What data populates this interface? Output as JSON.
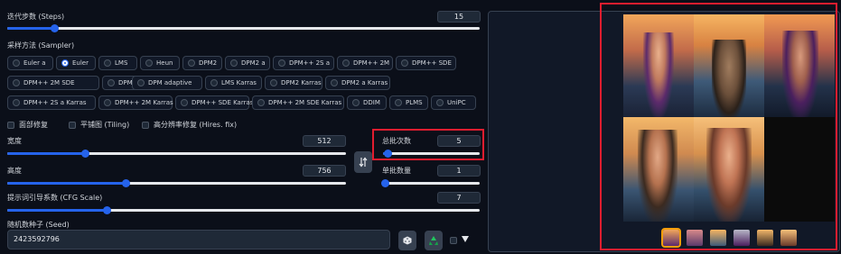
{
  "steps": {
    "label": "迭代步数 (Steps)",
    "value": "15",
    "level": 0.1
  },
  "sampler": {
    "label": "采样方法 (Sampler)",
    "selected": "Euler",
    "row1": [
      "Euler a",
      "Euler",
      "LMS",
      "Heun",
      "DPM2",
      "DPM2 a",
      "DPM++ 2S a",
      "DPM++ 2M",
      "DPM++ SDE"
    ],
    "row2": [
      "DPM++ 2M SDE",
      "DPM fast",
      "DPM adaptive",
      "LMS Karras",
      "DPM2 Karras",
      "DPM2 a Karras"
    ],
    "row3": [
      "DPM++ 2S a Karras",
      "DPM++ 2M Karras",
      "DPM++ SDE Karras",
      "DPM++ 2M SDE Karras",
      "DDIM",
      "PLMS",
      "UniPC"
    ]
  },
  "options": {
    "face_restore": "面部修复",
    "tiling": "平铺图 (Tiling)",
    "hires_fix": "高分辨率修复 (Hires. fix)"
  },
  "width": {
    "label": "宽度",
    "value": "512",
    "level": 0.23
  },
  "height": {
    "label": "高度",
    "value": "756",
    "level": 0.35
  },
  "batch_count": {
    "label": "总批次数",
    "value": "5",
    "level": 0.05
  },
  "batch_size": {
    "label": "单批数量",
    "value": "1",
    "level": 0.0
  },
  "swap_icon": "swap-icon",
  "cfg": {
    "label": "提示词引导系数 (CFG Scale)",
    "value": "7",
    "level": 0.21
  },
  "seed": {
    "label": "随机数种子 (Seed)",
    "value": "2423592796",
    "dice_icon": "dice-icon",
    "recycle_icon": "recycle-icon",
    "expand_icon": "triangle-down-icon"
  },
  "colors": {
    "accent": "#2563eb",
    "highlight": "#e11d2f",
    "bg": "#0b0f19"
  }
}
